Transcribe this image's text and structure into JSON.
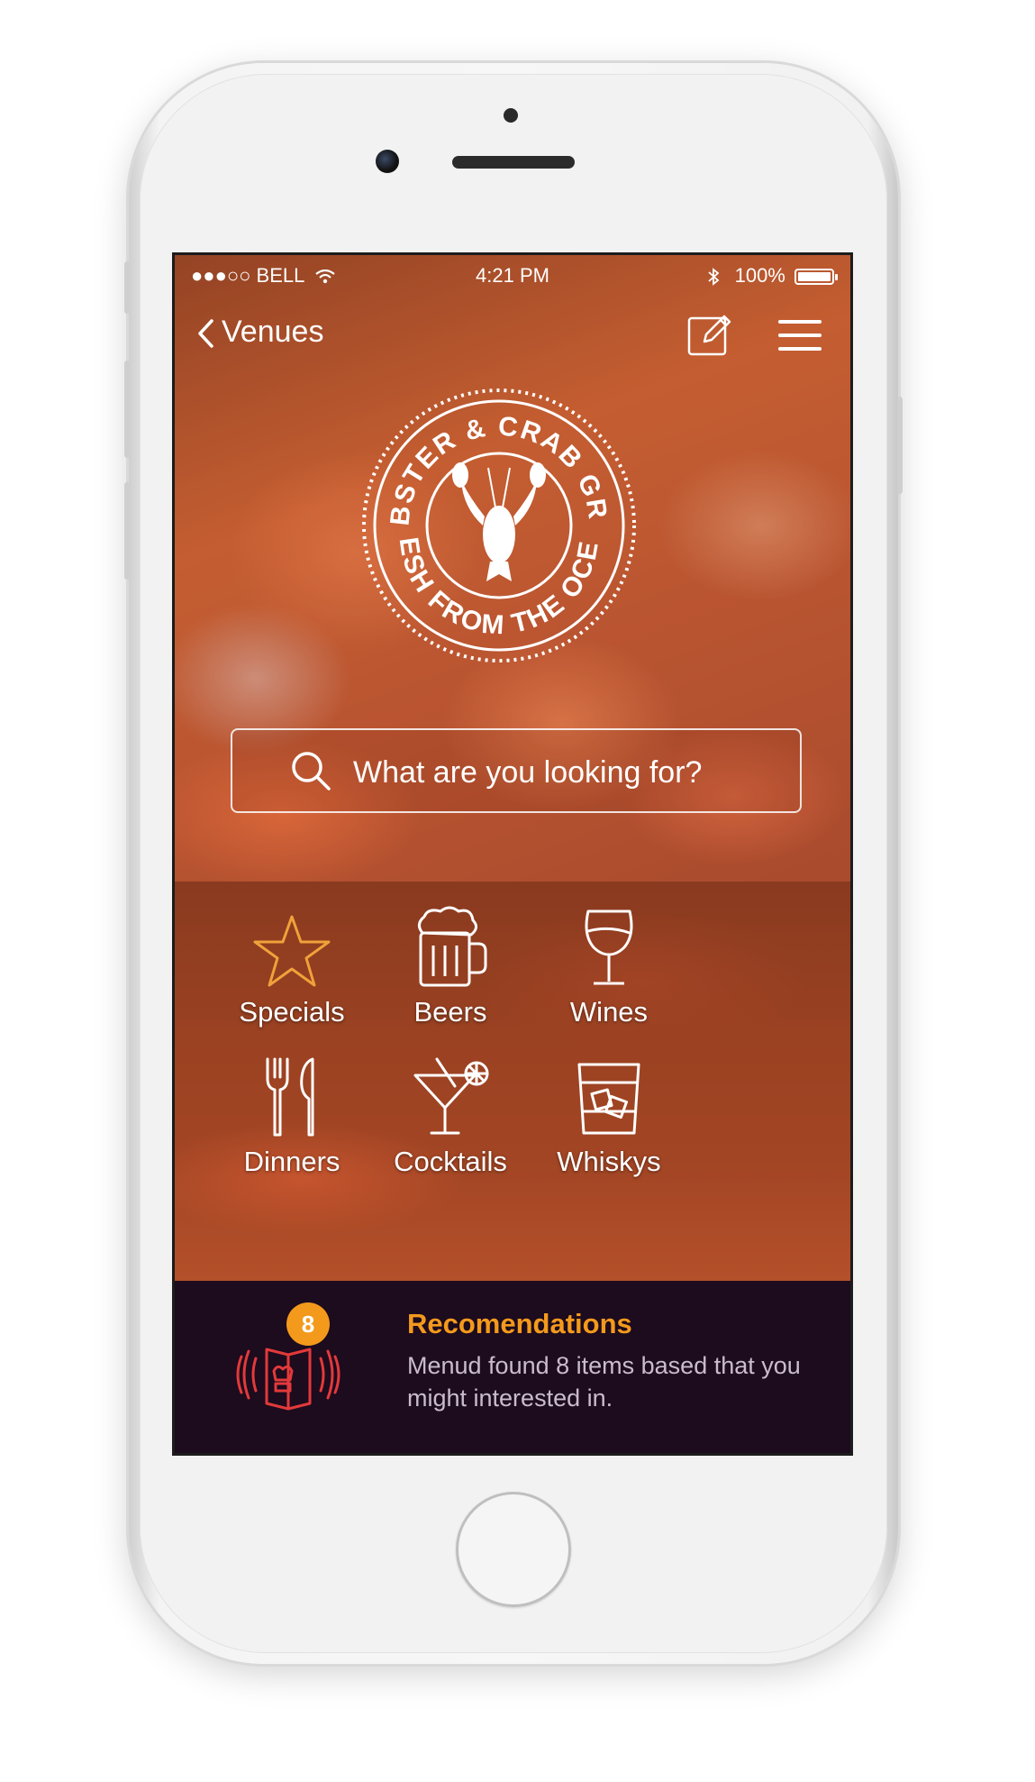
{
  "status_bar": {
    "carrier": "●●●○○ BELL",
    "time": "4:21 PM",
    "battery": "100%"
  },
  "nav": {
    "back_label": "Venues"
  },
  "logo": {
    "top_text": "LOBSTER & CRAB GRILL",
    "bottom_text": "FRESH FROM THE OCEAN"
  },
  "search": {
    "placeholder": "What are you looking for?"
  },
  "categories": [
    {
      "label": "Specials"
    },
    {
      "label": "Beers"
    },
    {
      "label": "Wines"
    },
    {
      "label": "Dinners"
    },
    {
      "label": "Cocktails"
    },
    {
      "label": "Whiskys"
    }
  ],
  "recommendations": {
    "badge_count": "8",
    "title": "Recomendations",
    "description": "Menud found 8 items based that you might interested in."
  },
  "colors": {
    "accent": "#f39a1c",
    "rec_icon": "#e23a3a",
    "rec_bg": "#1d0b1e"
  }
}
